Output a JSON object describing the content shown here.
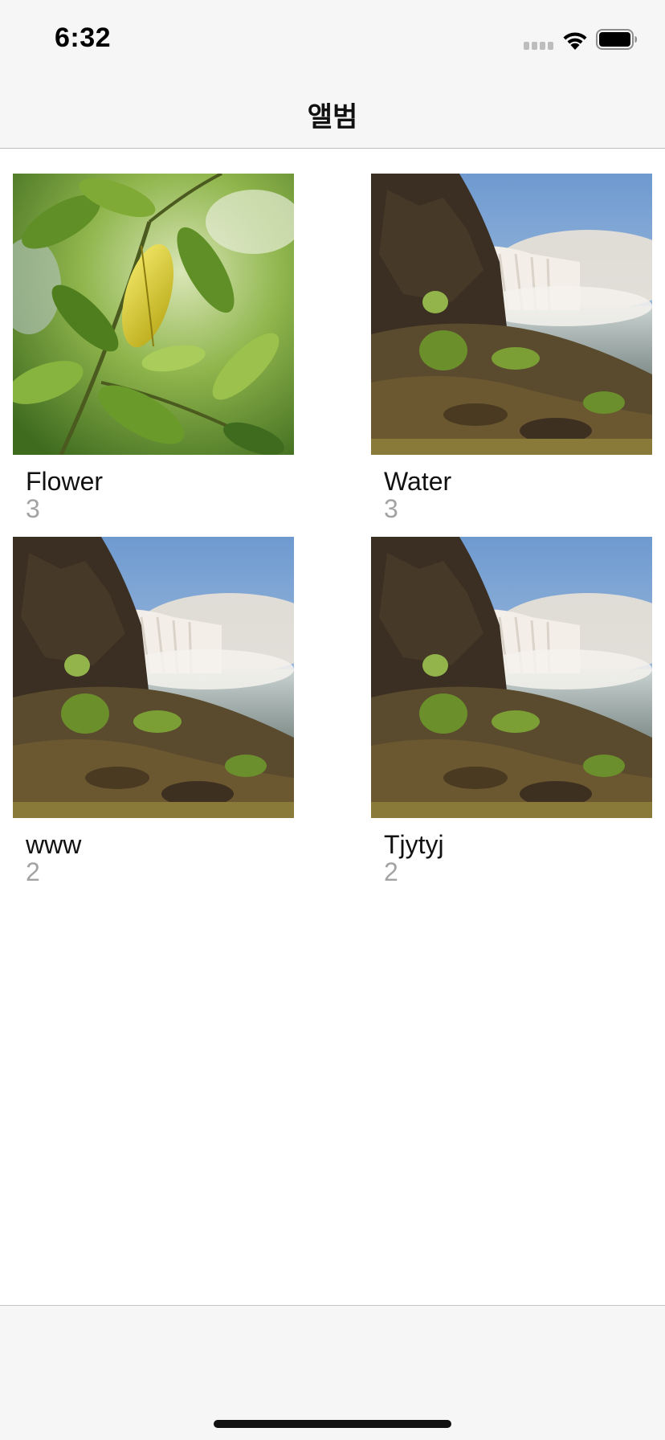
{
  "status_bar": {
    "time": "6:32"
  },
  "nav": {
    "title": "앨범"
  },
  "albums": [
    {
      "title": "Flower",
      "count": "3",
      "thumbnail": "leaves-photo"
    },
    {
      "title": "Water",
      "count": "3",
      "thumbnail": "waterfall-photo"
    },
    {
      "title": "www",
      "count": "2",
      "thumbnail": "waterfall-photo"
    },
    {
      "title": "Tjytyj",
      "count": "2",
      "thumbnail": "waterfall-photo"
    }
  ],
  "colors": {
    "bar_background": "#f6f6f6",
    "count_text": "#a3a3a3",
    "separator": "#bfbfbf"
  }
}
